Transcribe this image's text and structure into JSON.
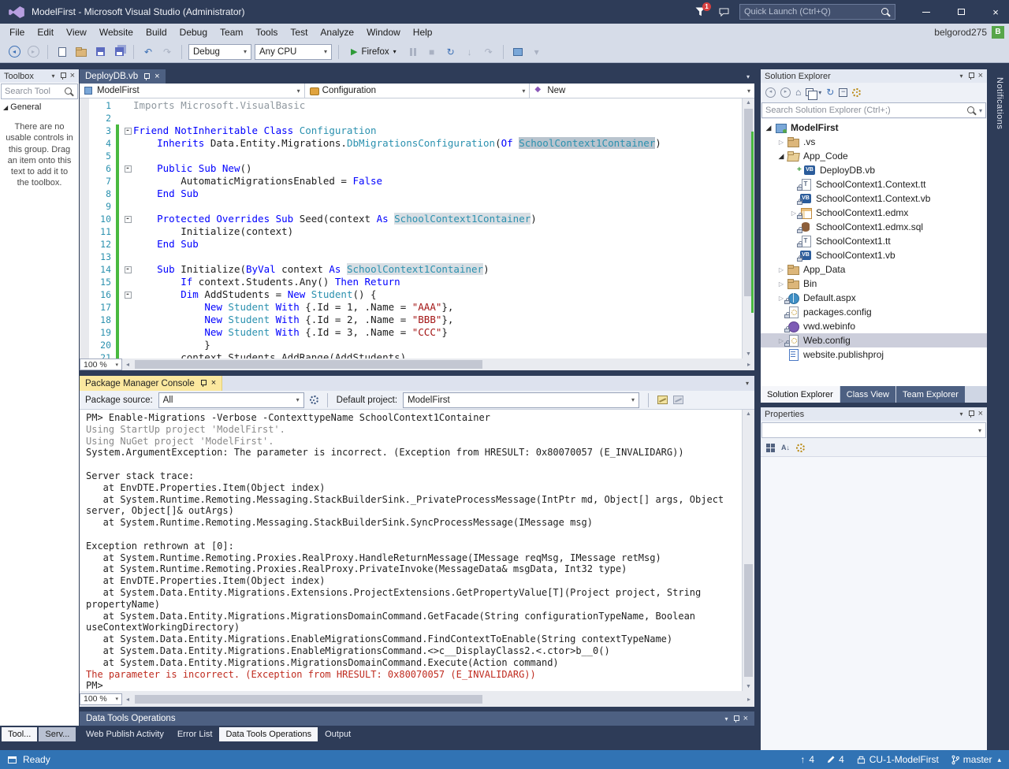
{
  "title_bar": {
    "title": "ModelFirst - Microsoft Visual Studio  (Administrator)",
    "quick_launch_placeholder": "Quick Launch (Ctrl+Q)",
    "notification_count": "1"
  },
  "menu_bar": {
    "items": [
      "File",
      "Edit",
      "View",
      "Website",
      "Build",
      "Debug",
      "Team",
      "Tools",
      "Test",
      "Analyze",
      "Window",
      "Help"
    ],
    "user_name": "belgorod275",
    "user_avatar": "B"
  },
  "toolbar": {
    "debug_config": "Debug",
    "platform": "Any CPU",
    "run_target": "Firefox"
  },
  "toolbox": {
    "title": "Toolbox",
    "search_placeholder": "Search Tool",
    "section": "General",
    "empty_text": "There are no usable controls in this group. Drag an item onto this text to add it to the toolbox.",
    "tabs": [
      {
        "label": "Tool...",
        "active": true
      },
      {
        "label": "Serv...",
        "active": false
      }
    ]
  },
  "editor": {
    "tab": "DeployDB.vb",
    "nav_project": "ModelFirst",
    "nav_type": "Configuration",
    "nav_member": "New",
    "zoom": "100 %",
    "code": [
      {
        "n": "1",
        "segs": [
          [
            "g",
            "Imports Microsoft.VisualBasic"
          ]
        ]
      },
      {
        "n": "2",
        "segs": []
      },
      {
        "n": "3",
        "fold": true,
        "chg": true,
        "segs": [
          [
            "k",
            "Friend NotInheritable Class "
          ],
          [
            "t",
            "Configuration"
          ]
        ]
      },
      {
        "n": "4",
        "chg": true,
        "segs": [
          [
            "n",
            "    "
          ],
          [
            "k",
            "Inherits "
          ],
          [
            "n",
            "Data.Entity.Migrations."
          ],
          [
            "t",
            "DbMigrationsConfiguration"
          ],
          [
            "n",
            "("
          ],
          [
            "k",
            "Of "
          ],
          [
            "hs",
            "SchoolContext1Container"
          ],
          [
            "n",
            ")"
          ]
        ]
      },
      {
        "n": "5",
        "chg": true,
        "segs": []
      },
      {
        "n": "6",
        "fold": true,
        "chg": true,
        "segs": [
          [
            "n",
            "    "
          ],
          [
            "k",
            "Public Sub New"
          ],
          [
            "n",
            "()"
          ]
        ]
      },
      {
        "n": "7",
        "chg": true,
        "segs": [
          [
            "n",
            "        AutomaticMigrationsEnabled = "
          ],
          [
            "k",
            "False"
          ]
        ]
      },
      {
        "n": "8",
        "chg": true,
        "segs": [
          [
            "n",
            "    "
          ],
          [
            "k",
            "End Sub"
          ]
        ]
      },
      {
        "n": "9",
        "chg": true,
        "segs": []
      },
      {
        "n": "10",
        "fold": true,
        "chg": true,
        "segs": [
          [
            "n",
            "    "
          ],
          [
            "k",
            "Protected Overrides Sub "
          ],
          [
            "n",
            "Seed(context "
          ],
          [
            "k",
            "As "
          ],
          [
            "h",
            "SchoolContext1Container"
          ],
          [
            "n",
            ")"
          ]
        ]
      },
      {
        "n": "11",
        "chg": true,
        "segs": [
          [
            "n",
            "        Initialize(context)"
          ]
        ]
      },
      {
        "n": "12",
        "chg": true,
        "segs": [
          [
            "n",
            "    "
          ],
          [
            "k",
            "End Sub"
          ]
        ]
      },
      {
        "n": "13",
        "chg": true,
        "segs": []
      },
      {
        "n": "14",
        "fold": true,
        "chg": true,
        "segs": [
          [
            "n",
            "    "
          ],
          [
            "k",
            "Sub "
          ],
          [
            "n",
            "Initialize("
          ],
          [
            "k",
            "ByVal "
          ],
          [
            "n",
            "context "
          ],
          [
            "k",
            "As "
          ],
          [
            "h",
            "SchoolContext1Container"
          ],
          [
            "n",
            ")"
          ]
        ]
      },
      {
        "n": "15",
        "chg": true,
        "segs": [
          [
            "n",
            "        "
          ],
          [
            "k",
            "If "
          ],
          [
            "n",
            "context.Students.Any() "
          ],
          [
            "k",
            "Then Return"
          ]
        ]
      },
      {
        "n": "16",
        "fold": true,
        "chg": true,
        "segs": [
          [
            "n",
            "        "
          ],
          [
            "k",
            "Dim "
          ],
          [
            "n",
            "AddStudents = "
          ],
          [
            "k",
            "New "
          ],
          [
            "t",
            "Student"
          ],
          [
            "n",
            "() {"
          ]
        ]
      },
      {
        "n": "17",
        "chg": true,
        "segs": [
          [
            "n",
            "            "
          ],
          [
            "k",
            "New "
          ],
          [
            "t",
            "Student"
          ],
          [
            "n",
            " "
          ],
          [
            "k",
            "With "
          ],
          [
            "n",
            "{.Id = 1, .Name = "
          ],
          [
            "s",
            "\"AAA\""
          ],
          [
            "n",
            "},"
          ]
        ]
      },
      {
        "n": "18",
        "chg": true,
        "segs": [
          [
            "n",
            "            "
          ],
          [
            "k",
            "New "
          ],
          [
            "t",
            "Student"
          ],
          [
            "n",
            " "
          ],
          [
            "k",
            "With "
          ],
          [
            "n",
            "{.Id = 2, .Name = "
          ],
          [
            "s",
            "\"BBB\""
          ],
          [
            "n",
            "},"
          ]
        ]
      },
      {
        "n": "19",
        "chg": true,
        "segs": [
          [
            "n",
            "            "
          ],
          [
            "k",
            "New "
          ],
          [
            "t",
            "Student"
          ],
          [
            "n",
            " "
          ],
          [
            "k",
            "With "
          ],
          [
            "n",
            "{.Id = 3, .Name = "
          ],
          [
            "s",
            "\"CCC\""
          ],
          [
            "n",
            "}"
          ]
        ]
      },
      {
        "n": "20",
        "chg": true,
        "segs": [
          [
            "n",
            "            }"
          ]
        ]
      },
      {
        "n": "21",
        "chg": true,
        "segs": [
          [
            "n",
            "        context.Students.AddRange(AddStudents)"
          ]
        ]
      }
    ]
  },
  "pmc": {
    "tab": "Package Manager Console",
    "package_source_label": "Package source:",
    "package_source": "All",
    "default_project_label": "Default project:",
    "default_project": "ModelFirst",
    "zoom": "100 %",
    "lines": [
      {
        "c": "n",
        "t": "PM> Enable-Migrations -Verbose -ContexttypeName SchoolContext1Container"
      },
      {
        "c": "g",
        "t": "Using StartUp project 'ModelFirst'."
      },
      {
        "c": "g",
        "t": "Using NuGet project 'ModelFirst'."
      },
      {
        "c": "n",
        "t": "System.ArgumentException: The parameter is incorrect. (Exception from HRESULT: 0x80070057 (E_INVALIDARG))"
      },
      {
        "c": "n",
        "t": ""
      },
      {
        "c": "n",
        "t": "Server stack trace: "
      },
      {
        "c": "n",
        "t": "   at EnvDTE.Properties.Item(Object index)"
      },
      {
        "c": "n",
        "t": "   at System.Runtime.Remoting.Messaging.StackBuilderSink._PrivateProcessMessage(IntPtr md, Object[] args, Object"
      },
      {
        "c": "n",
        "t": "server, Object[]& outArgs)"
      },
      {
        "c": "n",
        "t": "   at System.Runtime.Remoting.Messaging.StackBuilderSink.SyncProcessMessage(IMessage msg)"
      },
      {
        "c": "n",
        "t": ""
      },
      {
        "c": "n",
        "t": "Exception rethrown at [0]: "
      },
      {
        "c": "n",
        "t": "   at System.Runtime.Remoting.Proxies.RealProxy.HandleReturnMessage(IMessage reqMsg, IMessage retMsg)"
      },
      {
        "c": "n",
        "t": "   at System.Runtime.Remoting.Proxies.RealProxy.PrivateInvoke(MessageData& msgData, Int32 type)"
      },
      {
        "c": "n",
        "t": "   at EnvDTE.Properties.Item(Object index)"
      },
      {
        "c": "n",
        "t": "   at System.Data.Entity.Migrations.Extensions.ProjectExtensions.GetPropertyValue[T](Project project, String"
      },
      {
        "c": "n",
        "t": "propertyName)"
      },
      {
        "c": "n",
        "t": "   at System.Data.Entity.Migrations.MigrationsDomainCommand.GetFacade(String configurationTypeName, Boolean"
      },
      {
        "c": "n",
        "t": "useContextWorkingDirectory)"
      },
      {
        "c": "n",
        "t": "   at System.Data.Entity.Migrations.EnableMigrationsCommand.FindContextToEnable(String contextTypeName)"
      },
      {
        "c": "n",
        "t": "   at System.Data.Entity.Migrations.EnableMigrationsCommand.<>c__DisplayClass2.<.ctor>b__0()"
      },
      {
        "c": "n",
        "t": "   at System.Data.Entity.Migrations.MigrationsDomainCommand.Execute(Action command)"
      },
      {
        "c": "r",
        "t": "The parameter is incorrect. (Exception from HRESULT: 0x80070057 (E_INVALIDARG))"
      },
      {
        "c": "n",
        "t": "PM> "
      }
    ]
  },
  "bottom_panel": {
    "title": "Data Tools Operations",
    "tabs": [
      {
        "label": "Web Publish Activity",
        "active": false
      },
      {
        "label": "Error List",
        "active": false
      },
      {
        "label": "Data Tools Operations",
        "active": true
      },
      {
        "label": "Output",
        "active": false
      }
    ]
  },
  "solution_explorer": {
    "title": "Solution Explorer",
    "search_placeholder": "Search Solution Explorer (Ctrl+;)",
    "items": [
      {
        "label": "ModelFirst",
        "icon": "project",
        "indent": 0,
        "expander": "exp",
        "bold": true
      },
      {
        "label": ".vs",
        "icon": "folder",
        "indent": 1,
        "expander": "col"
      },
      {
        "label": "App_Code",
        "icon": "folder-open",
        "indent": 1,
        "expander": "exp"
      },
      {
        "label": "DeployDB.vb",
        "icon": "vb",
        "indent": 2,
        "plus": true
      },
      {
        "label": "SchoolContext1.Context.tt",
        "icon": "tt",
        "indent": 2,
        "lock": true
      },
      {
        "label": "SchoolContext1.Context.vb",
        "icon": "vb",
        "indent": 2,
        "lock": true
      },
      {
        "label": "SchoolContext1.edmx",
        "icon": "edmx",
        "indent": 2,
        "expander": "col",
        "lock": true
      },
      {
        "label": "SchoolContext1.edmx.sql",
        "icon": "sql",
        "indent": 2,
        "lock": true
      },
      {
        "label": "SchoolContext1.tt",
        "icon": "tt",
        "indent": 2,
        "lock": true
      },
      {
        "label": "SchoolContext1.vb",
        "icon": "vb",
        "indent": 2,
        "lock": true
      },
      {
        "label": "App_Data",
        "icon": "folder",
        "indent": 1,
        "expander": "col"
      },
      {
        "label": "Bin",
        "icon": "folder",
        "indent": 1,
        "expander": "col"
      },
      {
        "label": "Default.aspx",
        "icon": "aspx",
        "indent": 1,
        "expander": "col",
        "lock": true
      },
      {
        "label": "packages.config",
        "icon": "config",
        "indent": 1,
        "lock": true
      },
      {
        "label": "vwd.webinfo",
        "icon": "webinfo",
        "indent": 1,
        "lock": true
      },
      {
        "label": "Web.config",
        "icon": "config",
        "indent": 1,
        "expander": "col",
        "lock": true,
        "selected": true
      },
      {
        "label": "website.publishproj",
        "icon": "proj",
        "indent": 1
      }
    ],
    "tabs": [
      {
        "label": "Solution Explorer",
        "active": true
      },
      {
        "label": "Class View",
        "active": false
      },
      {
        "label": "Team Explorer",
        "active": false
      }
    ]
  },
  "properties": {
    "title": "Properties"
  },
  "status_bar": {
    "status": "Ready",
    "incoming_count": "4",
    "edits_count": "4",
    "repository": "CU-1-ModelFirst",
    "branch": "master"
  },
  "notifications_label": "Notifications",
  "colors": {
    "shell_background": "#2e3c58",
    "status_bar": "#3173b4",
    "active_tool_tab": "#fbe89f",
    "keyword": "#0000ff",
    "type": "#2b91af",
    "string": "#a31515",
    "console_error": "#bf2b1f",
    "change_bar": "#49b93f",
    "selection": "#cccedb"
  }
}
